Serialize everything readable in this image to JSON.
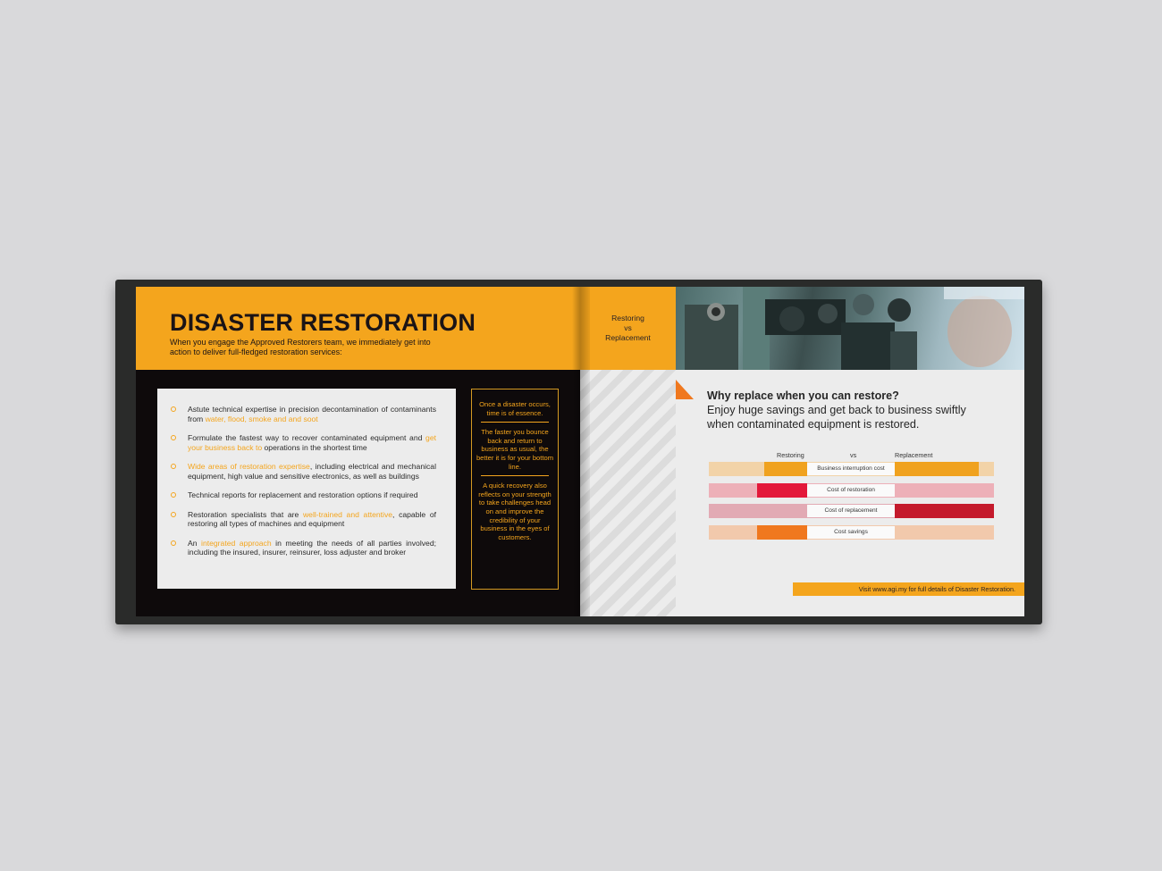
{
  "left_page": {
    "title": "DISASTER RESTORATION",
    "subtitle": "When you engage the Approved Restorers team, we immediately get into action to deliver full-fledged restoration services:",
    "bullets": [
      {
        "pre": "Astute technical expertise in precision decontamination of contaminants from ",
        "hl": "water, flood, smoke and and soot",
        "post": ""
      },
      {
        "pre": "Formulate the fastest way to recover contaminated equipment and ",
        "hl": "get your business back to",
        "post": " operations in the shortest time"
      },
      {
        "pre": "",
        "hl": "Wide areas of restoration expertise",
        "post": ", including electrical and mechanical equipment, high value and sensitive electronics, as well as buildings"
      },
      {
        "pre": "Technical reports for replacement and restoration options if required",
        "hl": "",
        "post": ""
      },
      {
        "pre": "Restoration specialists that are ",
        "hl": "well-trained and attentive",
        "post": ", capable of restoring all types of machines and equipment"
      },
      {
        "pre": "An ",
        "hl": "integrated approach",
        "post": " in meeting the needs of all parties involved; including the insured, insurer, reinsurer, loss adjuster and broker"
      }
    ],
    "side_notes": [
      "Once a disaster occurs, time is of essence.",
      "The faster you bounce back and return to business as usual, the better it is for your bottom line.",
      "A quick recovery also reflects on your strength to take challenges head on and improve the credibility of your business in the eyes of customers."
    ]
  },
  "right_page": {
    "section_label": {
      "line1": "Restoring",
      "line2": "vs",
      "line3": "Replacement"
    },
    "photo_icon": "industrial-machinery-photo",
    "headline_question": "Why replace when you can restore?",
    "headline_line2": "Enjoy huge savings and get back to business swiftly",
    "headline_line3": "when contaminated equipment is restored.",
    "comparison": {
      "left_heading": "Restoring",
      "vs": "vs",
      "right_heading": "Replacement",
      "rows": [
        {
          "label": "Business interruption cost",
          "base_color": "#f2d3a8",
          "accent_color": "#f0a21f"
        },
        {
          "label": "Cost of restoration",
          "base_color": "#edb0b8",
          "accent_color": "#e3183a"
        },
        {
          "label": "Cost of replacement",
          "base_color": "#e2aab4",
          "accent_color": "#c41a2c"
        },
        {
          "label": "Cost savings",
          "base_color": "#f2c9ac",
          "accent_color": "#f0781e"
        }
      ]
    },
    "footer": "Visit www.agi.my for full details of Disaster Restoration."
  },
  "colors": {
    "accent": "#f4a51d",
    "dark": "#0e0a0b",
    "paper": "#ececec",
    "cover": "#2a2b2a"
  }
}
